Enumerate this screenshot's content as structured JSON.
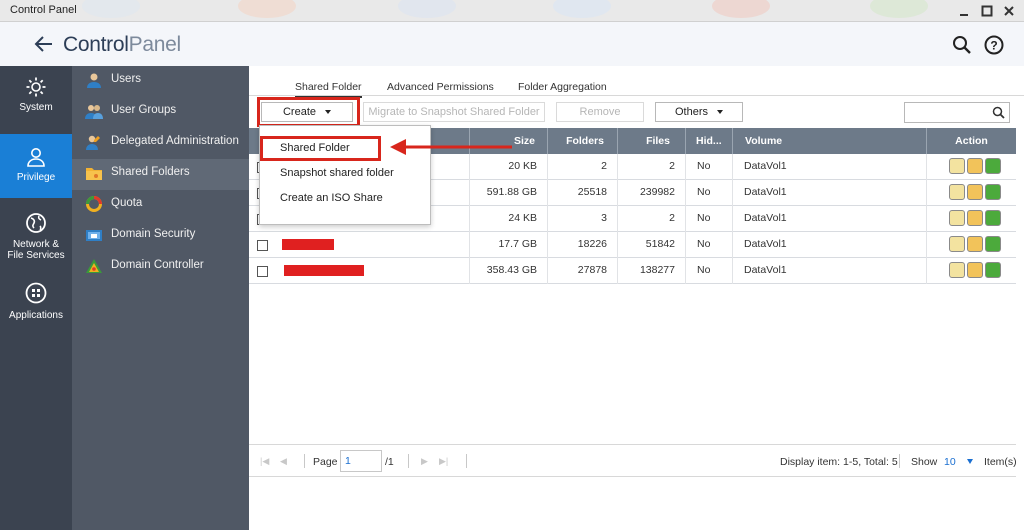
{
  "window": {
    "title": "Control Panel"
  },
  "header": {
    "title_bold": "Control",
    "title_light": "Panel"
  },
  "rail": [
    {
      "label": "System",
      "icon": "gear-icon"
    },
    {
      "label": "Privilege",
      "icon": "user-icon",
      "active": true
    },
    {
      "label": "Network &",
      "label2": "File Services",
      "icon": "globe-icon"
    },
    {
      "label": "Applications",
      "icon": "grid-icon"
    }
  ],
  "nav": [
    {
      "label": "Users",
      "icon": "user-icon"
    },
    {
      "label": "User Groups",
      "icon": "user-group-icon"
    },
    {
      "label": "Delegated Administration",
      "icon": "delegated-admin-icon"
    },
    {
      "label": "Shared Folders",
      "icon": "folder-icon",
      "active": true
    },
    {
      "label": "Quota",
      "icon": "quota-icon"
    },
    {
      "label": "Domain Security",
      "icon": "domain-security-icon"
    },
    {
      "label": "Domain Controller",
      "icon": "domain-controller-icon"
    }
  ],
  "tabs": [
    {
      "label": "Shared Folder",
      "active": true
    },
    {
      "label": "Advanced Permissions"
    },
    {
      "label": "Folder Aggregation"
    }
  ],
  "toolbar": {
    "create": "Create",
    "migrate": "Migrate to Snapshot Shared Folder",
    "remove": "Remove",
    "others": "Others"
  },
  "menu": [
    "Shared Folder",
    "Snapshot shared folder",
    "Create an ISO Share"
  ],
  "columns": [
    "Size",
    "Folders",
    "Files",
    "Hid...",
    "Volume",
    "Action"
  ],
  "rows": [
    {
      "size": "20 KB",
      "folders": "2",
      "files": "2",
      "hidden": "No",
      "volume": "DataVol1"
    },
    {
      "size": "591.88 GB",
      "folders": "25518",
      "files": "239982",
      "hidden": "No",
      "volume": "DataVol1"
    },
    {
      "size": "24 KB",
      "folders": "3",
      "files": "2",
      "hidden": "No",
      "volume": "DataVol1"
    },
    {
      "size": "17.7 GB",
      "folders": "18226",
      "files": "51842",
      "hidden": "No",
      "volume": "DataVol1"
    },
    {
      "size": "358.43 GB",
      "folders": "27878",
      "files": "138277",
      "hidden": "No",
      "volume": "DataVol1"
    }
  ],
  "pager": {
    "page_label": "Page",
    "page_value": "1",
    "total_pages": "/1",
    "display": "Display item: 1-5, Total: 5",
    "show_label": "Show",
    "show_value": "10",
    "items_label": "Item(s)"
  },
  "colors": {
    "accent": "#1a7fd6",
    "highlight": "#d8261c",
    "rail": "#3b4350",
    "nav": "#505865"
  }
}
